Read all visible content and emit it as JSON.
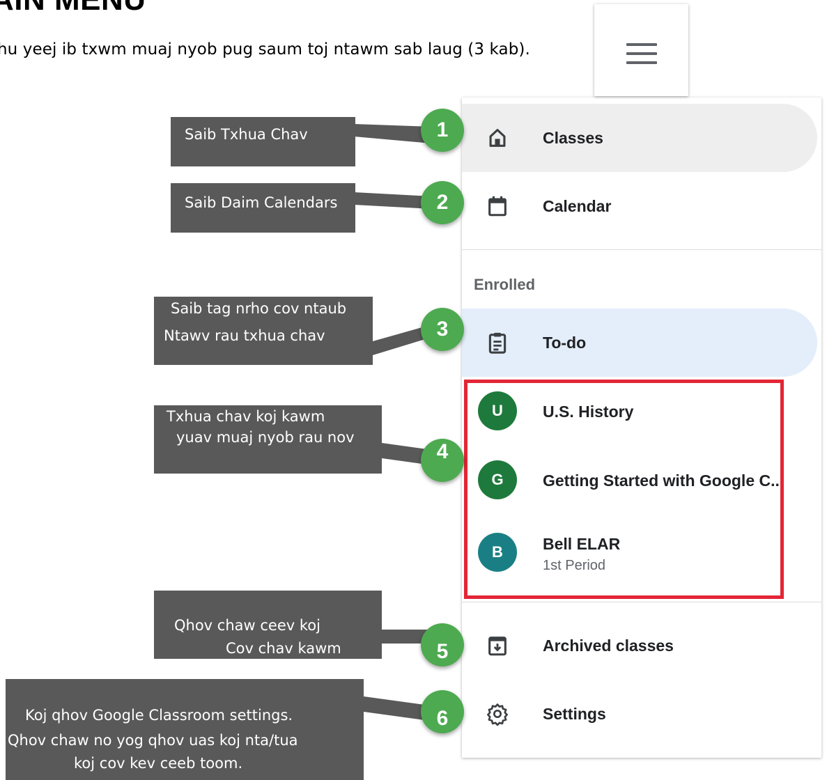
{
  "page": {
    "title": "AIN MENU",
    "intro": "hu yeej ib txwm muaj nyob pug saum toj ntawm sab laug (3 kab)."
  },
  "menu": {
    "classes_label": "Classes",
    "calendar_label": "Calendar",
    "enrolled_label": "Enrolled",
    "todo_label": "To-do",
    "courses": [
      {
        "initial": "U",
        "name": "U.S. History",
        "color": "#1e7a3c"
      },
      {
        "initial": "G",
        "name": "Getting Started with Google C...",
        "color": "#1e7a3c"
      },
      {
        "initial": "B",
        "name": "Bell ELAR",
        "subtitle": "1st Period",
        "color": "#1a7f85"
      }
    ],
    "archived_label": "Archived classes",
    "settings_label": "Settings"
  },
  "callouts": [
    {
      "number": "1",
      "lines": [
        "Saib Txhua Chav"
      ]
    },
    {
      "number": "2",
      "lines": [
        "Saib Daim Calendars"
      ]
    },
    {
      "number": "3",
      "lines": [
        "Saib tag nrho cov ntaub",
        "Ntawv rau txhua chav"
      ]
    },
    {
      "number": "4",
      "lines": [
        "Txhua chav koj kawm",
        "yuav muaj nyob rau nov"
      ]
    },
    {
      "number": "5",
      "lines": [
        "Qhov chaw ceev koj",
        "Cov chav kawm"
      ]
    },
    {
      "number": "6",
      "lines": [
        "Koj qhov Google Classroom settings.",
        "Qhov chaw no yog qhov uas koj nta/tua",
        "koj cov kev ceeb toom."
      ]
    }
  ],
  "colors": {
    "callout_bg": "#595959",
    "badge_green": "#4daa50",
    "highlight_red": "#e32636",
    "classes_hover": "#eeeeee",
    "todo_active": "#e3eefa"
  }
}
